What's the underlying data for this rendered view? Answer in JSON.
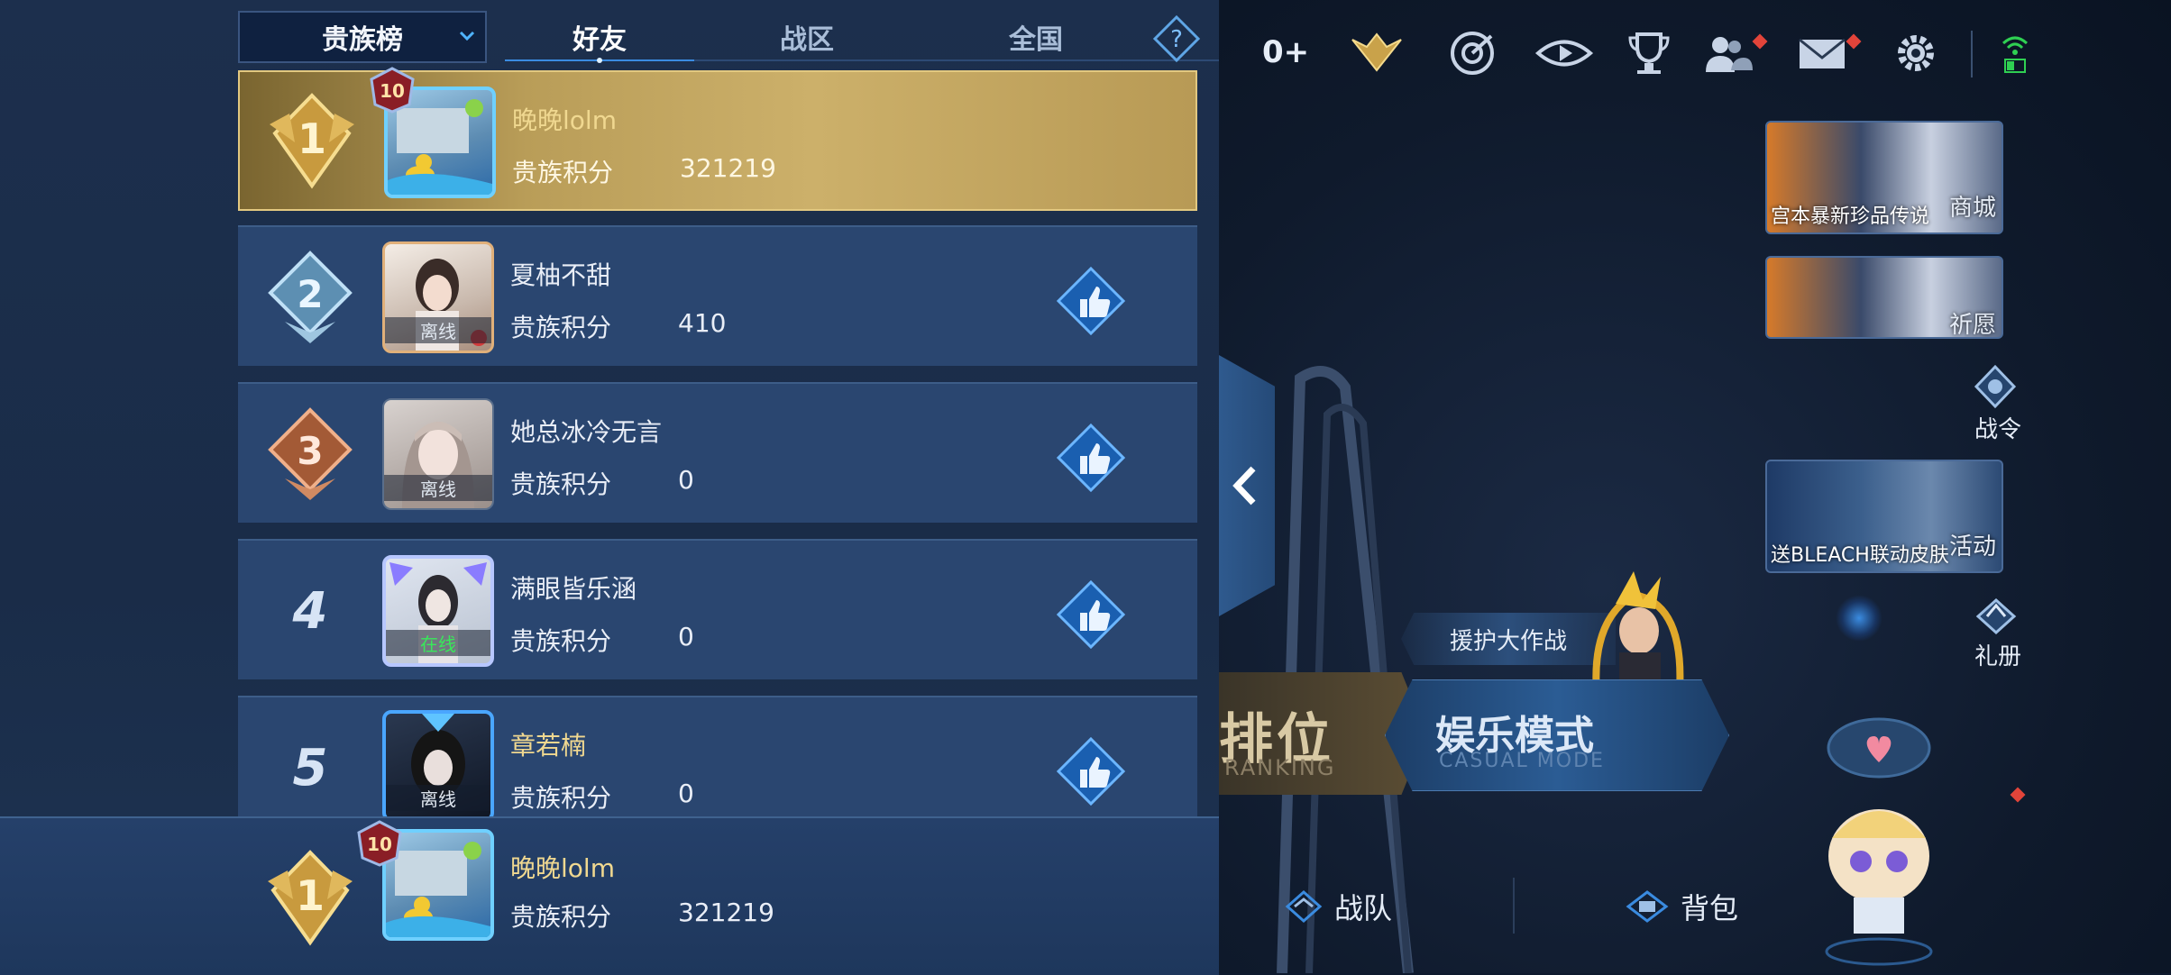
{
  "leaderboard": {
    "dropdown_label": "贵族榜",
    "tabs": [
      {
        "label": "好友",
        "active": true
      },
      {
        "label": "战区",
        "active": false
      },
      {
        "label": "全国",
        "active": false
      }
    ],
    "score_label": "贵族积分",
    "rows": [
      {
        "rank": "1",
        "name": "晚晚lolm",
        "score": "321219",
        "avatar_tag": "",
        "badge_level": "10"
      },
      {
        "rank": "2",
        "name": "夏柚不甜",
        "score": "410",
        "avatar_tag": "离线"
      },
      {
        "rank": "3",
        "name": "她总冰冷无言",
        "score": "0",
        "avatar_tag": "离线"
      },
      {
        "rank": "4",
        "name": "满眼皆乐涵",
        "score": "0",
        "avatar_tag": "在线"
      },
      {
        "rank": "5",
        "name": "章若楠",
        "score": "0",
        "avatar_tag": "离线"
      }
    ],
    "self": {
      "rank": "1",
      "name": "晚晚lolm",
      "score": "321219",
      "badge_level": "10"
    }
  },
  "game": {
    "zero_plus": "0+",
    "icons": [
      "wings-icon",
      "target-icon",
      "eye-icon",
      "trophy-icon",
      "friends-icon",
      "mail-icon",
      "gear-icon",
      "wifi-icon"
    ],
    "promos": [
      {
        "caption": "宫本暴新珍品传说",
        "label": "商城"
      },
      {
        "caption": "",
        "label": "祈愿"
      },
      {
        "caption": "送BLEACH联动皮肤",
        "label": "活动"
      }
    ],
    "side_labels": {
      "battle_pass": "战令",
      "gift_book": "礼册"
    },
    "event_pill": "援护大作战",
    "modes": {
      "rank_text": "排位",
      "rank_sub": "RANKING",
      "casual_text": "娱乐模式",
      "casual_sub": "CASUAL MODE"
    },
    "bottom_nav": {
      "team": "战队",
      "bag": "背包"
    },
    "colors": {
      "gold": "#ccb06a",
      "row_bg": "#2a4670",
      "accent_blue": "#3a8be0",
      "red_dot": "#e2443a"
    }
  }
}
